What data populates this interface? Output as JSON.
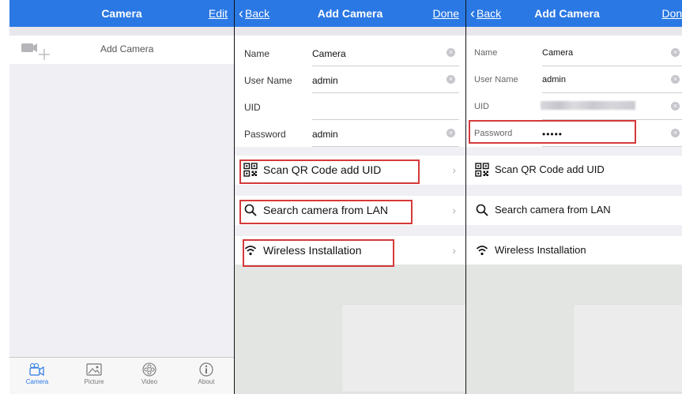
{
  "panel1": {
    "nav": {
      "title": "Camera",
      "edit": "Edit"
    },
    "add_row_label": "Add Camera",
    "tabs": [
      {
        "label": "Camera",
        "icon": "camera-icon",
        "active": true
      },
      {
        "label": "Picture",
        "icon": "picture-icon",
        "active": false
      },
      {
        "label": "Video",
        "icon": "video-icon",
        "active": false
      },
      {
        "label": "About",
        "icon": "info-icon",
        "active": false
      }
    ]
  },
  "panel2": {
    "nav": {
      "back": "Back",
      "title": "Add Camera",
      "done": "Done"
    },
    "fields": [
      {
        "label": "Name",
        "value": "Camera"
      },
      {
        "label": "User Name",
        "value": "admin"
      },
      {
        "label": "UID",
        "value": ""
      },
      {
        "label": "Password",
        "value": "admin"
      }
    ],
    "options": [
      {
        "label": "Scan QR Code add UID",
        "icon": "qr-code-icon"
      },
      {
        "label": "Search camera from LAN",
        "icon": "search-icon"
      },
      {
        "label": "Wireless Installation",
        "icon": "wifi-icon"
      }
    ]
  },
  "panel3": {
    "nav": {
      "back": "Back",
      "title": "Add Camera",
      "done": "Done"
    },
    "fields": [
      {
        "label": "Name",
        "value": "Camera"
      },
      {
        "label": "User Name",
        "value": "admin"
      },
      {
        "label": "UID",
        "value": ""
      },
      {
        "label": "Password",
        "value": "•••••"
      }
    ],
    "options": [
      {
        "label": "Scan QR Code add UID",
        "icon": "qr-code-icon"
      },
      {
        "label": "Search camera from LAN",
        "icon": "search-icon"
      },
      {
        "label": "Wireless Installation",
        "icon": "wifi-icon"
      }
    ]
  },
  "colors": {
    "nav_blue": "#2a78e4",
    "highlight_red": "#d6393a"
  }
}
